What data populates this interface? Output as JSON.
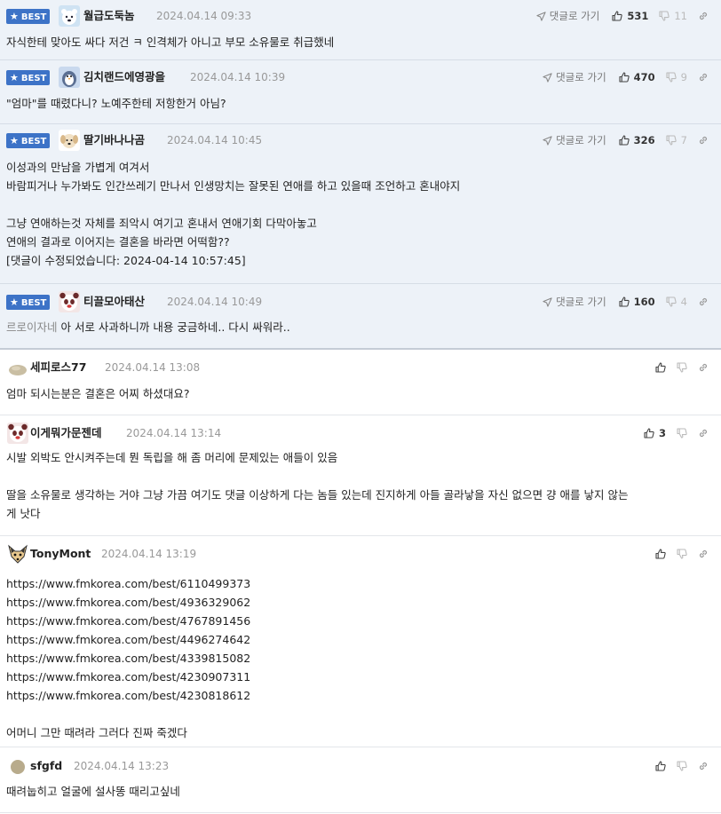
{
  "labels": {
    "best": "BEST",
    "reply_link": "댓글로 가기"
  },
  "colors": {
    "best_bg": "#edf2f8",
    "badge": "#3d73c7",
    "date": "#999999"
  },
  "comments": [
    {
      "best": true,
      "avatar": "polar-bear",
      "nick": "월급도둑놈",
      "date": "2024.04.14 09:33",
      "up": "531",
      "down": "11",
      "lines": [
        "자식한테 맞아도 싸다 저건 ㅋ 인격체가 아니고 부모 소유물로 취급했네"
      ]
    },
    {
      "best": true,
      "avatar": "penguin",
      "nick": "김치랜드에영광을",
      "date": "2024.04.14 10:39",
      "up": "470",
      "down": "9",
      "lines": [
        "\"엄마\"를 때렸다니? 노예주한테 저항한거 아님?"
      ]
    },
    {
      "best": true,
      "avatar": "dog",
      "nick": "딸기바나나곰",
      "date": "2024.04.14 10:45",
      "up": "326",
      "down": "7",
      "lines": [
        "이성과의 만남을 가볍게 여겨서",
        "바람피거나 누가봐도 인간쓰레기 만나서 인생망치는 잘못된 연애를 하고 있을때 조언하고 혼내야지",
        "",
        "그냥 연애하는것 자체를 죄악시 여기고 혼내서 연애기회 다막아놓고",
        "연애의 결과로 이어지는 결혼을 바라면 어떡함??",
        "[댓글이 수정되었습니다: 2024-04-14 10:57:45]"
      ]
    },
    {
      "best": true,
      "avatar": "panda",
      "nick": "티끌모아태산",
      "date": "2024.04.14 10:49",
      "up": "160",
      "down": "4",
      "mention": "르로이자네",
      "lines": [
        " 아 서로 사과하니까 내용 궁금하네.. 다시 싸워라.."
      ]
    },
    {
      "best": false,
      "avatar": "rock",
      "nick": "세피로스77",
      "date": "2024.04.14 13:08",
      "up": "",
      "down": "",
      "lines": [
        "엄마 되시는분은 결혼은 어찌 하셨대요?"
      ]
    },
    {
      "best": false,
      "avatar": "panda",
      "nick": "이게뭐가문젠데",
      "date": "2024.04.14 13:14",
      "up": "3",
      "down": "",
      "lines": [
        "시발 외박도 안시켜주는데 뭔 독립을 해 좀 머리에 문제있는 애들이 있음",
        "",
        "딸을 소유물로 생각하는 거야 그냥 가끔 여기도 댓글 이상하게 다는 놈들 있는데 진지하게 아들 골라낳을 자신 없으면 걍 애를 낳지 않는",
        "게 낫다"
      ]
    },
    {
      "best": false,
      "avatar": "fox",
      "nick": "TonyMont",
      "date": "2024.04.14 13:19",
      "up": "",
      "down": "",
      "lines": [
        "https://www.fmkorea.com/best/6110499373",
        "https://www.fmkorea.com/best/4936329062",
        "https://www.fmkorea.com/best/4767891456",
        "https://www.fmkorea.com/best/4496274642",
        "https://www.fmkorea.com/best/4339815082",
        "https://www.fmkorea.com/best/4230907311",
        "https://www.fmkorea.com/best/4230818612",
        "",
        "어머니 그만 때려라 그러다 진짜 죽겠다"
      ]
    },
    {
      "best": false,
      "avatar": "circle",
      "nick": "sfgfd",
      "date": "2024.04.14 13:23",
      "up": "",
      "down": "",
      "lines": [
        "때려눕히고 얼굴에 설사똥 때리고싶네"
      ]
    }
  ]
}
